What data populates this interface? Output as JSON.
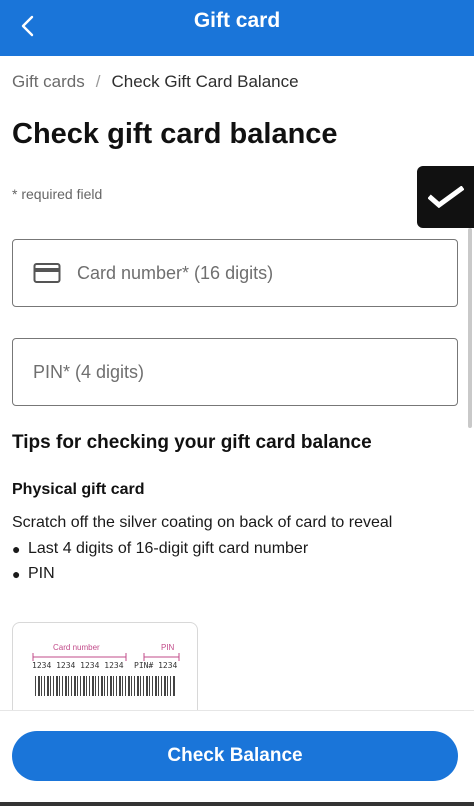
{
  "header": {
    "title": "Gift card"
  },
  "breadcrumb": {
    "parent": "Gift cards",
    "separator": "/",
    "current": "Check Gift Card Balance"
  },
  "page": {
    "title": "Check gift card balance",
    "required_note": "* required field"
  },
  "form": {
    "card_number": {
      "placeholder": "Card number* (16 digits)",
      "value": ""
    },
    "pin": {
      "placeholder": "PIN* (4 digits)",
      "value": ""
    }
  },
  "tips": {
    "title": "Tips for checking your gift card balance",
    "physical": {
      "title": "Physical gift card",
      "instruction": "Scratch off the silver coating on back of card to reveal",
      "bullets": [
        "Last 4 digits of 16-digit gift card number",
        "PIN"
      ]
    },
    "illustration": {
      "card_number_label": "Card number",
      "pin_label": "PIN",
      "digits": "1234 1234 1234 1234",
      "pin_digits": "PIN# 1234"
    }
  },
  "actions": {
    "check_balance": "Check Balance"
  },
  "colors": {
    "primary": "#1a75d9",
    "illustration_accent": "#c24b8a"
  },
  "icons": {
    "back": "chevron-left-icon",
    "card": "credit-card-icon",
    "badge": "checkmark-icon"
  }
}
